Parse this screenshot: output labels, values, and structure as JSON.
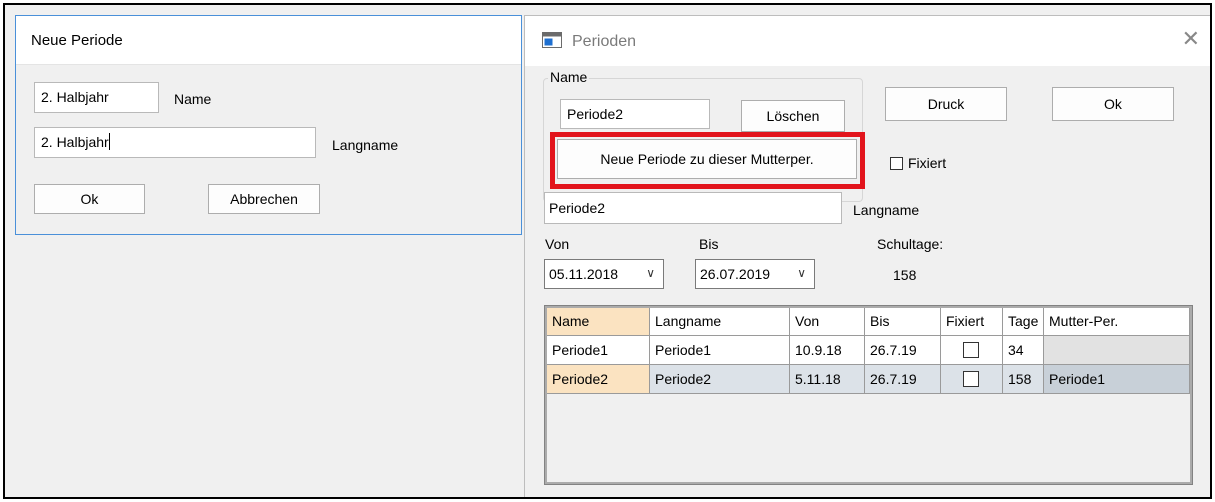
{
  "neue_periode": {
    "title": "Neue Periode",
    "name_value": "2. Halbjahr",
    "name_label": "Name",
    "langname_value": "2. Halbjahr",
    "langname_label": "Langname",
    "ok_label": "Ok",
    "abbrechen_label": "Abbrechen"
  },
  "perioden": {
    "title": "Perioden",
    "name_group_label": "Name",
    "name_value": "Periode2",
    "loeschen_label": "Löschen",
    "neue_periode_label": "Neue Periode zu dieser Mutterper.",
    "druck_label": "Druck",
    "ok_label": "Ok",
    "fixiert_label": "Fixiert",
    "langname_value": "Periode2",
    "langname_label": "Langname",
    "von_label": "Von",
    "bis_label": "Bis",
    "von_value": "05.11.2018",
    "bis_value": "26.07.2019",
    "schultage_label": "Schultage:",
    "schultage_value": "158",
    "table": {
      "headers": [
        "Name",
        "Langname",
        "Von",
        "Bis",
        "Fixiert",
        "Tage",
        "Mutter-Per."
      ],
      "rows": [
        {
          "name": "Periode1",
          "langname": "Periode1",
          "von": "10.9.18",
          "bis": "26.7.19",
          "fixiert": false,
          "tage": "34",
          "mutter": ""
        },
        {
          "name": "Periode2",
          "langname": "Periode2",
          "von": "5.11.18",
          "bis": "26.7.19",
          "fixiert": false,
          "tage": "158",
          "mutter": "Periode1"
        }
      ]
    }
  },
  "colors": {
    "highlight": "#e2141c",
    "selected_cell": "#fbe3c1",
    "dialog_border": "#4a90d9"
  }
}
